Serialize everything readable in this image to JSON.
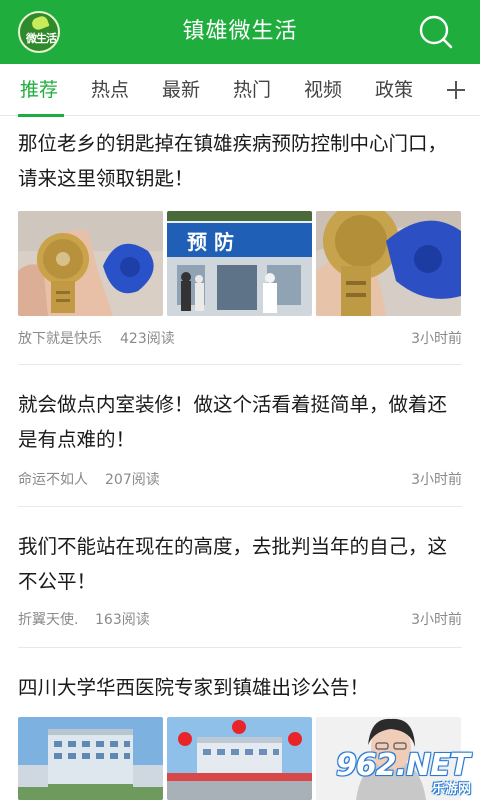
{
  "app": {
    "logo_text": "微生活",
    "title": "镇雄微生活"
  },
  "tabs": [
    {
      "label": "推荐",
      "active": true
    },
    {
      "label": "热点",
      "active": false
    },
    {
      "label": "最新",
      "active": false
    },
    {
      "label": "热门",
      "active": false
    },
    {
      "label": "视频",
      "active": false
    },
    {
      "label": "政策",
      "active": false
    }
  ],
  "icons": {
    "search": "search-icon",
    "add": "plus-icon"
  },
  "articles": [
    {
      "title": "那位老乡的钥匙掉在镇雄疾病预防控制中心门口，请来这里领取钥匙！",
      "author": "放下就是快乐",
      "reads": "423阅读",
      "time": "3小时前",
      "images": [
        {
          "alt": "hand holding key with blue tag"
        },
        {
          "alt": "预防 control center entrance",
          "sign_text": "预 防"
        },
        {
          "alt": "close-up of key and blue tag"
        }
      ]
    },
    {
      "title": "就会做点内室装修！做这个活看着挺简单，做着还是有点难的！",
      "author": "命运不如人",
      "reads": "207阅读",
      "time": "3小时前"
    },
    {
      "title": "我们不能站在现在的高度，去批判当年的自己，这不公平！",
      "author": "折翼天使.",
      "reads": "163阅读",
      "time": "3小时前"
    },
    {
      "title": "四川大学华西医院专家到镇雄出诊公告！",
      "images": [
        {
          "alt": "hospital building"
        },
        {
          "alt": "hospital building with red lanterns"
        },
        {
          "alt": "doctor portrait"
        }
      ]
    }
  ],
  "watermark": {
    "main": "962.NET",
    "sub": "乐游网"
  },
  "colors": {
    "brand_green": "#1fae3d",
    "meta_gray": "#8a8a8a",
    "watermark_blue": "#2a7bd4"
  }
}
